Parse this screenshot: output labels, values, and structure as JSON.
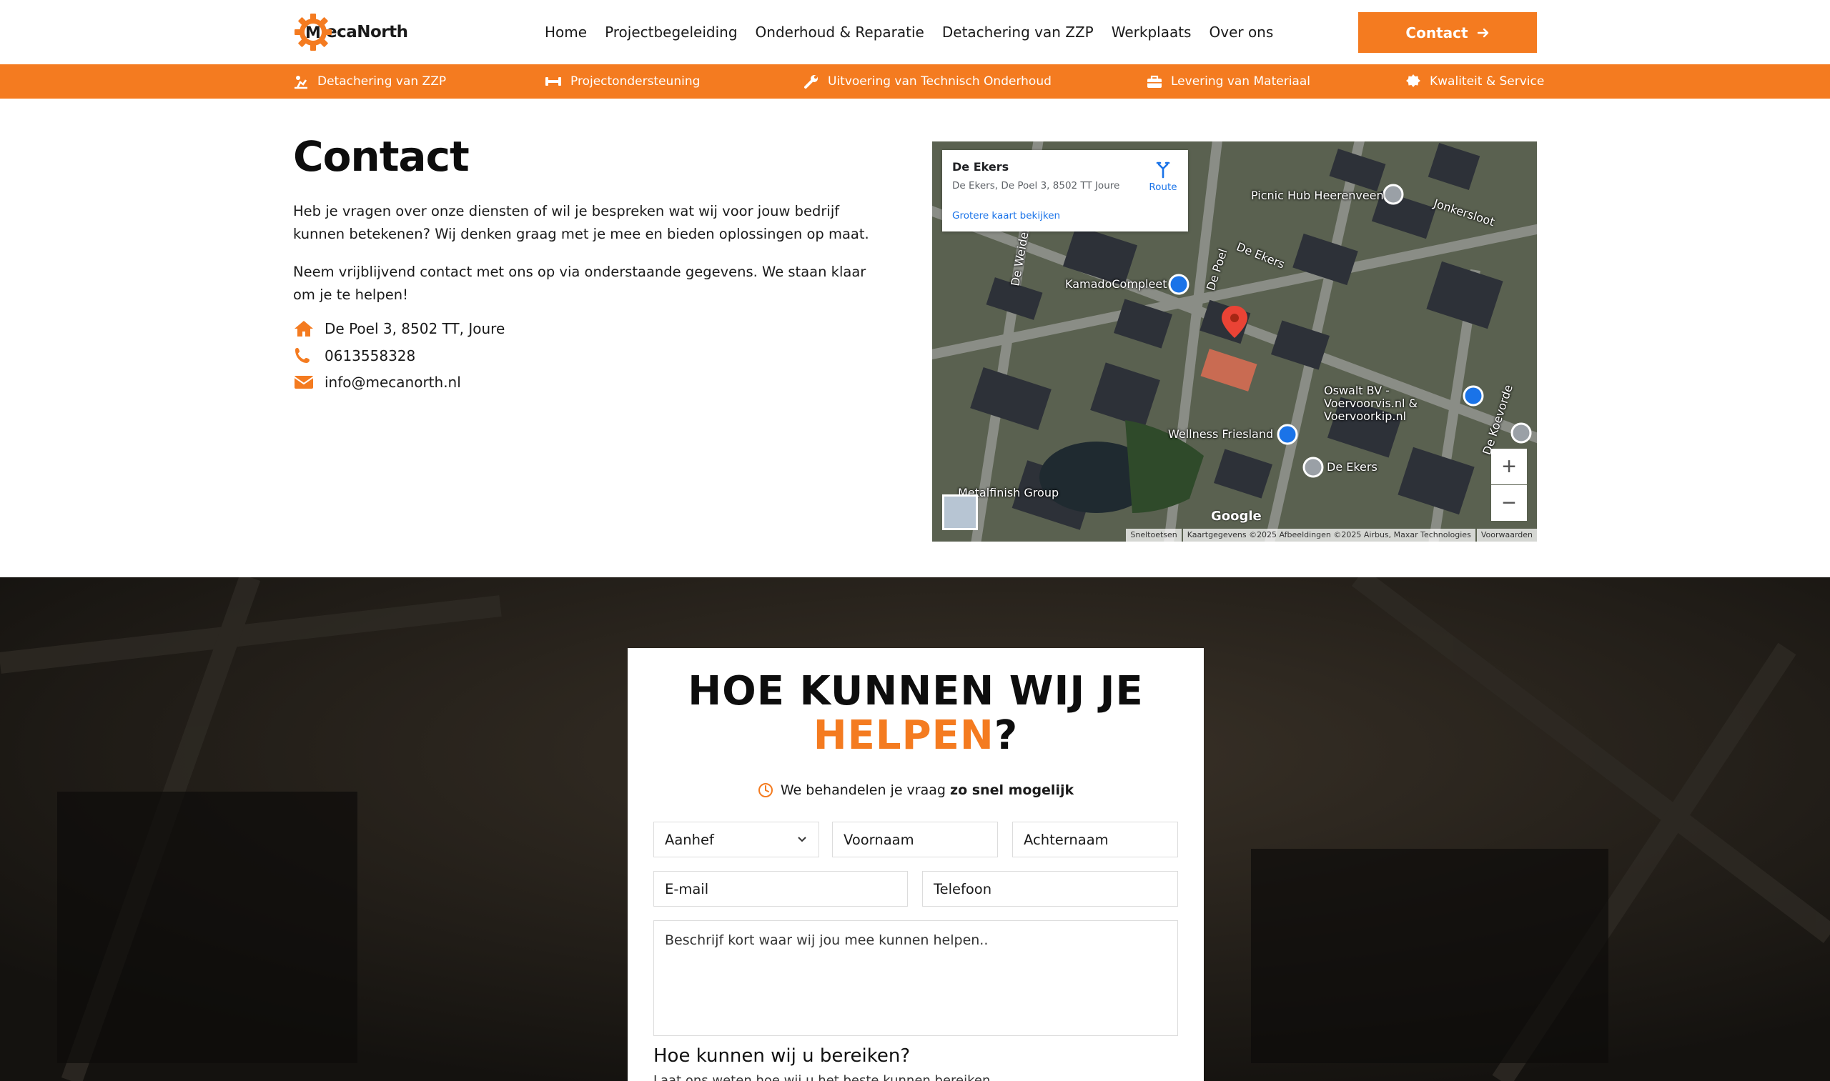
{
  "brand": {
    "name": "ecaNorth",
    "letter": "M",
    "accent": "#f47b20"
  },
  "nav": [
    "Home",
    "Projectbegeleiding",
    "Onderhoud & Reparatie",
    "Detachering van ZZP",
    "Werkplaats",
    "Over ons"
  ],
  "cta_label": "Contact",
  "services": [
    "Detachering van ZZP",
    "Projectondersteuning",
    "Uitvoering van Technisch Onderhoud",
    "Levering van Materiaal",
    "Kwaliteit & Service"
  ],
  "contact": {
    "title": "Contact",
    "p1": "Heb je vragen over onze diensten of wil je bespreken wat wij voor jouw bedrijf kunnen betekenen? Wij denken graag met je mee en bieden oplossingen op maat.",
    "p2": "Neem vrijblijvend contact met ons op via onderstaande gegevens. We staan klaar om je te helpen!",
    "address": "De Poel 3, 8502 TT, Joure",
    "phone": "0613558328",
    "email": "info@mecanorth.nl"
  },
  "map": {
    "place": "De Ekers",
    "address": "De Ekers, De Poel 3, 8502 TT Joure",
    "route": "Route",
    "larger_map": "Grotere kaart bekijken",
    "labels": [
      "Picnic Hub Heerenveen",
      "Jonkersloot",
      "KamadoCompleet",
      "De Ekers",
      "De Poel",
      "De Weiden",
      "Oswalt BV - Voervoorvis.nl & Voervoorkip.nl",
      "Wellness Friesland",
      "De Ekers",
      "Metalfinish Group",
      "De Koevorde"
    ],
    "google": "Google",
    "attribution": [
      "Sneltoetsen",
      "Kaartgegevens ©2025 Afbeeldingen ©2025 Airbus, Maxar Technologies",
      "Voorwaarden"
    ]
  },
  "form": {
    "heading_line1": "HOE KUNNEN WIJ JE",
    "heading_accent": "HELPEN",
    "heading_end": "?",
    "note_pre": "We behandelen je vraag ",
    "note_bold": "zo snel mogelijk",
    "salutation": "Aanhef",
    "first_name": "Voornaam",
    "last_name": "Achternaam",
    "email": "E-mail",
    "phone": "Telefoon",
    "message": "Beschrijf kort waar wij jou mee kunnen helpen..",
    "reach_title": "Hoe kunnen wij u bereiken?",
    "reach_sub": "Laat ons weten hoe wij u het beste kunnen bereiken"
  }
}
